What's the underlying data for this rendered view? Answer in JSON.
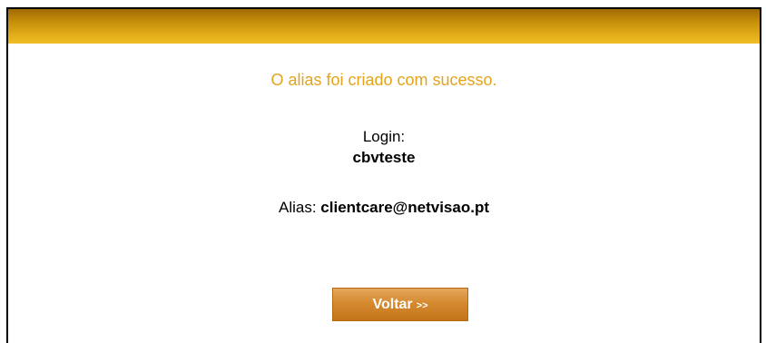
{
  "message": {
    "success": "O alias foi criado com sucesso."
  },
  "details": {
    "login_label": "Login:",
    "login_value": "cbvteste",
    "alias_label": "Alias:",
    "alias_value": "clientcare@netvisao.pt"
  },
  "actions": {
    "back_label": "Voltar",
    "back_arrows": ">>"
  },
  "colors": {
    "header_gradient_top": "#a06a05",
    "header_gradient_bottom": "#efbd25",
    "success_text": "#e3a31b",
    "button_orange": "#d58a2f"
  }
}
